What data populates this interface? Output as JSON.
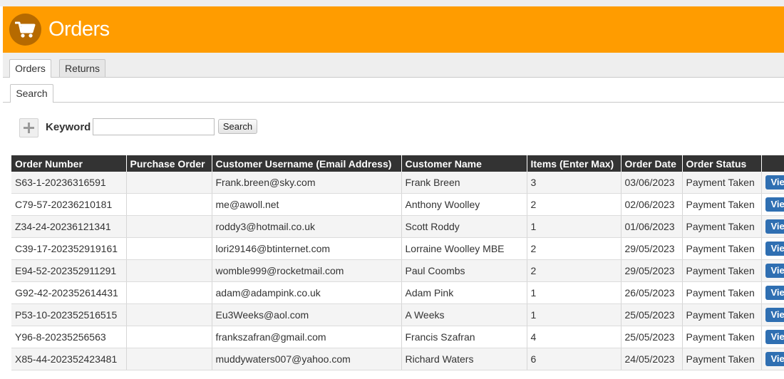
{
  "header": {
    "title": "Orders",
    "icon": "shopping-cart-icon",
    "bg_color": "#ff9c00"
  },
  "tabs": [
    {
      "label": "Orders",
      "active": true
    },
    {
      "label": "Returns",
      "active": false
    }
  ],
  "subtabs": [
    {
      "label": "Search",
      "active": true
    }
  ],
  "search": {
    "label": "Keyword",
    "value": "",
    "button_label": "Search"
  },
  "table": {
    "columns": [
      "Order Number",
      "Purchase Order",
      "Customer Username (Email Address)",
      "Customer Name",
      "Items (Enter Max)",
      "Order Date",
      "Order Status",
      ""
    ],
    "rows": [
      {
        "order_number": "S63-1-20236316591",
        "purchase_order": "",
        "email": "Frank.breen@sky.com",
        "name": "Frank Breen",
        "items": "3",
        "date": "03/06/2023",
        "status": "Payment Taken",
        "action": "View"
      },
      {
        "order_number": "C79-57-20236210181",
        "purchase_order": "",
        "email": "me@awoll.net",
        "name": "Anthony Woolley",
        "items": "2",
        "date": "02/06/2023",
        "status": "Payment Taken",
        "action": "View"
      },
      {
        "order_number": "Z34-24-20236121341",
        "purchase_order": "",
        "email": "roddy3@hotmail.co.uk",
        "name": "Scott Roddy",
        "items": "1",
        "date": "01/06/2023",
        "status": "Payment Taken",
        "action": "View"
      },
      {
        "order_number": "C39-17-202352919161",
        "purchase_order": "",
        "email": "lori29146@btinternet.com",
        "name": "Lorraine Woolley MBE",
        "items": "2",
        "date": "29/05/2023",
        "status": "Payment Taken",
        "action": "View"
      },
      {
        "order_number": "E94-52-202352911291",
        "purchase_order": "",
        "email": "womble999@rocketmail.com",
        "name": "Paul Coombs",
        "items": "2",
        "date": "29/05/2023",
        "status": "Payment Taken",
        "action": "View"
      },
      {
        "order_number": "G92-42-202352614431",
        "purchase_order": "",
        "email": "adam@adampink.co.uk",
        "name": "Adam Pink",
        "items": "1",
        "date": "26/05/2023",
        "status": "Payment Taken",
        "action": "View"
      },
      {
        "order_number": "P53-10-202352516515",
        "purchase_order": "",
        "email": "Eu3Weeks@aol.com",
        "name": "A Weeks",
        "items": "1",
        "date": "25/05/2023",
        "status": "Payment Taken",
        "action": "View"
      },
      {
        "order_number": "Y96-8-20235256563",
        "purchase_order": "",
        "email": "frankszafran@gmail.com",
        "name": "Francis Szafran",
        "items": "4",
        "date": "25/05/2023",
        "status": "Payment Taken",
        "action": "View"
      },
      {
        "order_number": "X85-44-202352423481",
        "purchase_order": "",
        "email": "muddywaters007@yahoo.com",
        "name": "Richard Waters",
        "items": "6",
        "date": "24/05/2023",
        "status": "Payment Taken",
        "action": "View"
      }
    ]
  }
}
